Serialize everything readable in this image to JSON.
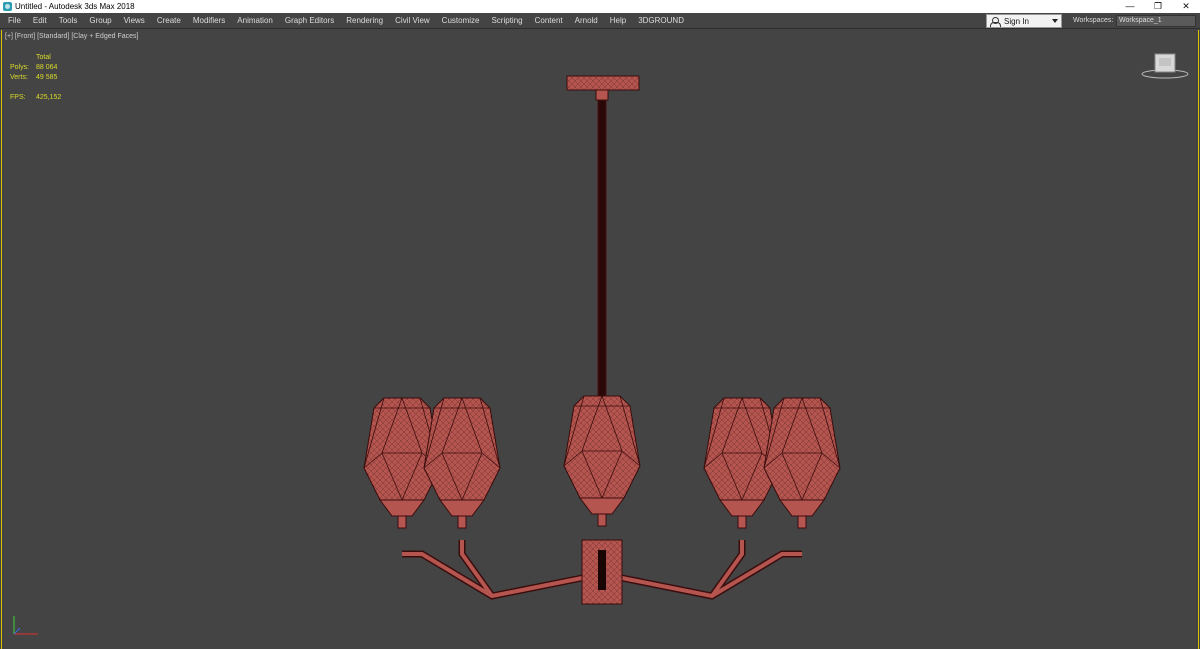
{
  "window": {
    "title": "Untitled - Autodesk 3ds Max 2018",
    "controls": {
      "minimize": "—",
      "restore": "❐",
      "close": "✕"
    }
  },
  "menubar": {
    "items": [
      "File",
      "Edit",
      "Tools",
      "Group",
      "Views",
      "Create",
      "Modifiers",
      "Animation",
      "Graph Editors",
      "Rendering",
      "Civil View",
      "Customize",
      "Scripting",
      "Content",
      "Arnold",
      "Help",
      "3DGROUND"
    ],
    "sign_in": "Sign In",
    "workspaces_label": "Workspaces:",
    "workspace_value": "Workspace_1"
  },
  "viewport": {
    "label": "[+] [Front] [Standard] [Clay + Edged Faces]",
    "stats": {
      "header": "Total",
      "polys_label": "Polys:",
      "polys_value": "88 064",
      "verts_label": "Verts:",
      "verts_value": "49 585",
      "fps_label": "FPS:",
      "fps_value": "425,152"
    },
    "colors": {
      "background": "#444444",
      "active_border": "#d9c400",
      "stats_text": "#dada2a",
      "model_fill": "#b5554f",
      "model_wire": "#3a0d0d",
      "rod": "#2a0808"
    },
    "icons": {
      "viewcube": "viewcube-icon",
      "axis": "axis-tripod-icon"
    }
  }
}
